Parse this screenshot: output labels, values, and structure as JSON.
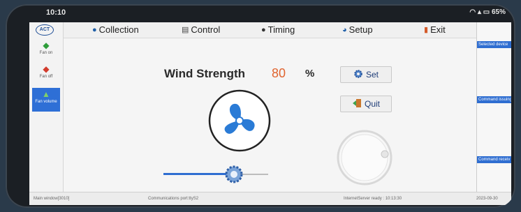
{
  "statusbar": {
    "time": "10:10",
    "battery": "65%"
  },
  "menu": {
    "collection": "Collection",
    "control": "Control",
    "timing": "Timing",
    "setup": "Setup",
    "exit": "Exit"
  },
  "sidebar": {
    "logo": "ACT",
    "fan_on": "Fan on",
    "fan_off": "Fan off",
    "fan_volume": "Fan volume"
  },
  "right_panel": {
    "selected_device": "Selected device",
    "command_issuing": "Command issuing",
    "command_receiving": "Command receiv"
  },
  "main": {
    "wind_strength_label": "Wind Strength",
    "wind_strength_value": "80",
    "unit": "%",
    "set_label": "Set",
    "quit_label": "Quit",
    "slider_level": 0.8
  },
  "footer": {
    "left": "Main window[3010]",
    "mid": "Communications port:ttyS2",
    "right": "InternetServer ready : 10:13:30",
    "date": "2023-09-30"
  },
  "colors": {
    "accent": "#2f6ed1",
    "value": "#e0642f"
  }
}
